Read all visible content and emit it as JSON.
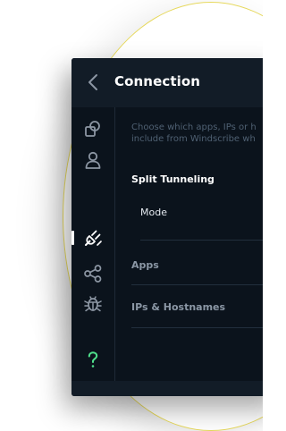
{
  "header": {
    "title": "Connection"
  },
  "sidebar": {
    "items": [
      {
        "icon": "shapes-icon",
        "color": "#8c96a3"
      },
      {
        "icon": "user-icon",
        "color": "#8c96a3"
      },
      {
        "icon": "plug-icon",
        "color": "#ffffff",
        "active": true
      },
      {
        "icon": "share-icon",
        "color": "#8c96a3"
      },
      {
        "icon": "bug-icon",
        "color": "#8c96a3"
      },
      {
        "icon": "help-icon",
        "color": "#4fe08c"
      },
      {
        "icon": "book-icon",
        "color": "#f4d83a"
      },
      {
        "icon": "power-icon",
        "color": "#ff4c4c"
      }
    ]
  },
  "main": {
    "description_line1": "Choose which apps, IPs or h",
    "description_line2": "include from Windscribe wh",
    "section_title": "Split Tunneling",
    "mode_label": "Mode",
    "apps_label": "Apps",
    "hosts_label": "IPs & Hostnames"
  }
}
